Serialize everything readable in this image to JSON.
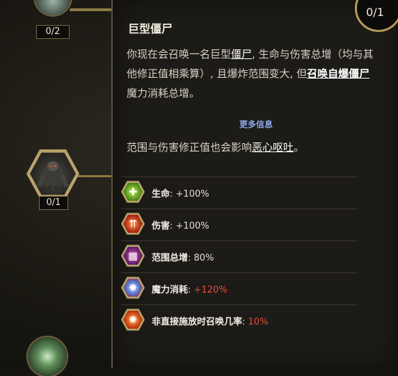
{
  "background": {
    "top_node_label": "0/2",
    "mid_node_label": "0/1"
  },
  "tooltip": {
    "counter": "0/1",
    "title": "巨型僵尸",
    "desc_a": "你现在会召唤一名巨型",
    "desc_kw1": "僵尸",
    "desc_b": ", 生命与伤害总增（均与其他修正值相乘算）, 且爆炸范围变大, 但",
    "desc_kw2": "召唤自爆僵尸",
    "desc_c": "魔力消耗总增。",
    "more_info": "更多信息",
    "extra_a": "范围与伤害修正值也会影响",
    "extra_kw": "恶心呕吐",
    "extra_b": "。",
    "stats": [
      {
        "icon": "life-icon",
        "label": "生命",
        "value": "+100%",
        "color": "#e4dfd2"
      },
      {
        "icon": "damage-icon",
        "label": "伤害",
        "value": "+100%",
        "color": "#e4dfd2"
      },
      {
        "icon": "area-icon",
        "label": "范围总增",
        "value": "80%",
        "color": "#e4dfd2"
      },
      {
        "icon": "mana-cost-icon",
        "label": "魔力消耗",
        "value": "+120%",
        "color": "#ee4a3a"
      },
      {
        "icon": "summon-chance-icon",
        "label": "非直接施放时召唤几率",
        "value": "10%",
        "color": "#ee4a3a"
      }
    ]
  }
}
